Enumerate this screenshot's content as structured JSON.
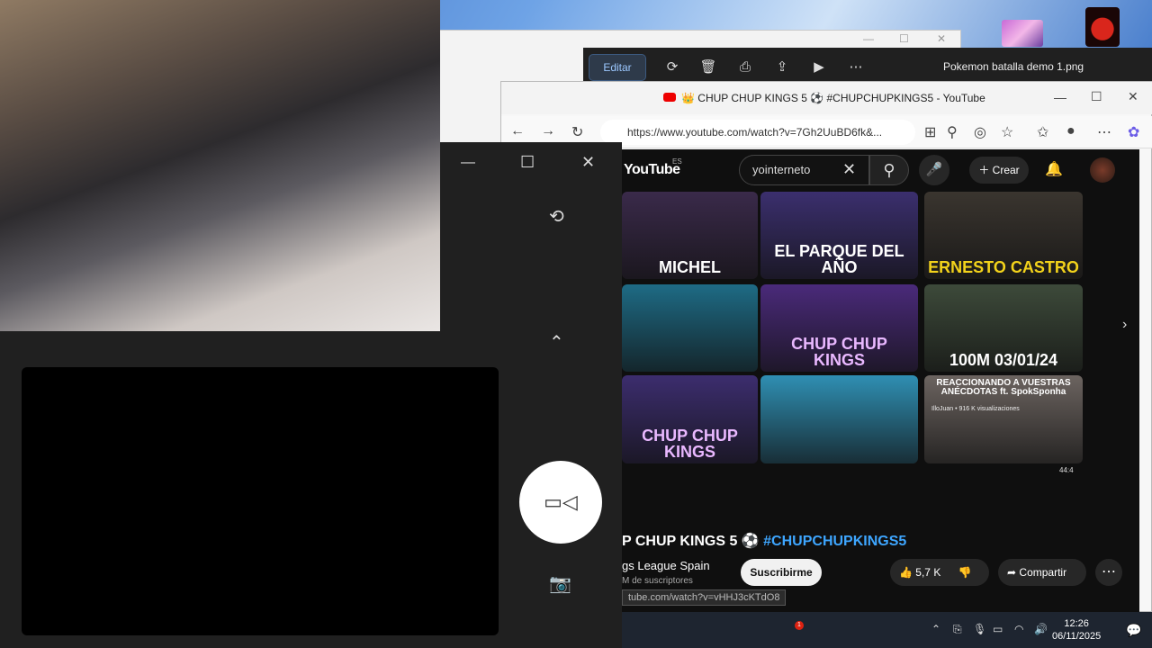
{
  "photos": {
    "edit_label": "Editar",
    "title": "Pokemon batalla demo 1.png",
    "icons": [
      "rotate-icon",
      "delete-icon",
      "print-icon",
      "share-icon",
      "slideshow-icon",
      "more-icon"
    ]
  },
  "browser": {
    "tab_title": "👑 CHUP CHUP KINGS 5 ⚽ #CHUPCHUPKINGS5 - YouTube",
    "url": "https://www.youtube.com/watch?v=7Gh2UuBD6fk&..."
  },
  "youtube": {
    "logo": "YouTube",
    "region": "ES",
    "search_value": "yointerneto",
    "create_label": "Crear",
    "thumbnails": [
      {
        "text": "MICHEL",
        "bg": "#3a2a4a",
        "color": "#ffffff"
      },
      {
        "text": "EL PARQUE DEL AÑO",
        "bg": "#3b2f6e",
        "color": "#ffffff"
      },
      {
        "text": "ERNESTO CASTRO",
        "bg": "#3a352f",
        "color": "#f2d21b"
      },
      {
        "text": "",
        "bg": "#1e6b85",
        "color": "#ffffff"
      },
      {
        "text": "CHUP CHUP KINGS",
        "bg": "#4a2a7a",
        "color": "#e9b8ff"
      },
      {
        "text": "100M 03/01/24",
        "bg": "#3d4a3a",
        "color": "#ffffff"
      },
      {
        "text": "CHUP CHUP KINGS",
        "bg": "#3c2d6e",
        "color": "#e9b8ff"
      },
      {
        "text": "",
        "bg": "#2f8fb3",
        "color": "#ffffff"
      },
      {
        "text": "REACCIONANDO A VUESTRAS ANÉCDOTAS ft. SpokSponha",
        "bg": "#6c6460",
        "color": "#ffffff"
      }
    ],
    "thumb_caption": "IlloJuan • 916 K visualizaciones",
    "thumb_duration": "44:4",
    "video_title_start": "P CHUP KINGS 5 ⚽ ",
    "video_title_tag": "#CHUPCHUPKINGS5",
    "channel_name": "gs League Spain",
    "channel_subs": "M de suscriptores",
    "subscribe_label": "Suscribirme",
    "likes": "5,7 K",
    "share_label": "Compartir",
    "status_url": "tube.com/watch?v=vHHJ3cKTdO8"
  },
  "taskbar": {
    "time": "12:26",
    "date": "06/11/2025",
    "notification_count": "1"
  }
}
